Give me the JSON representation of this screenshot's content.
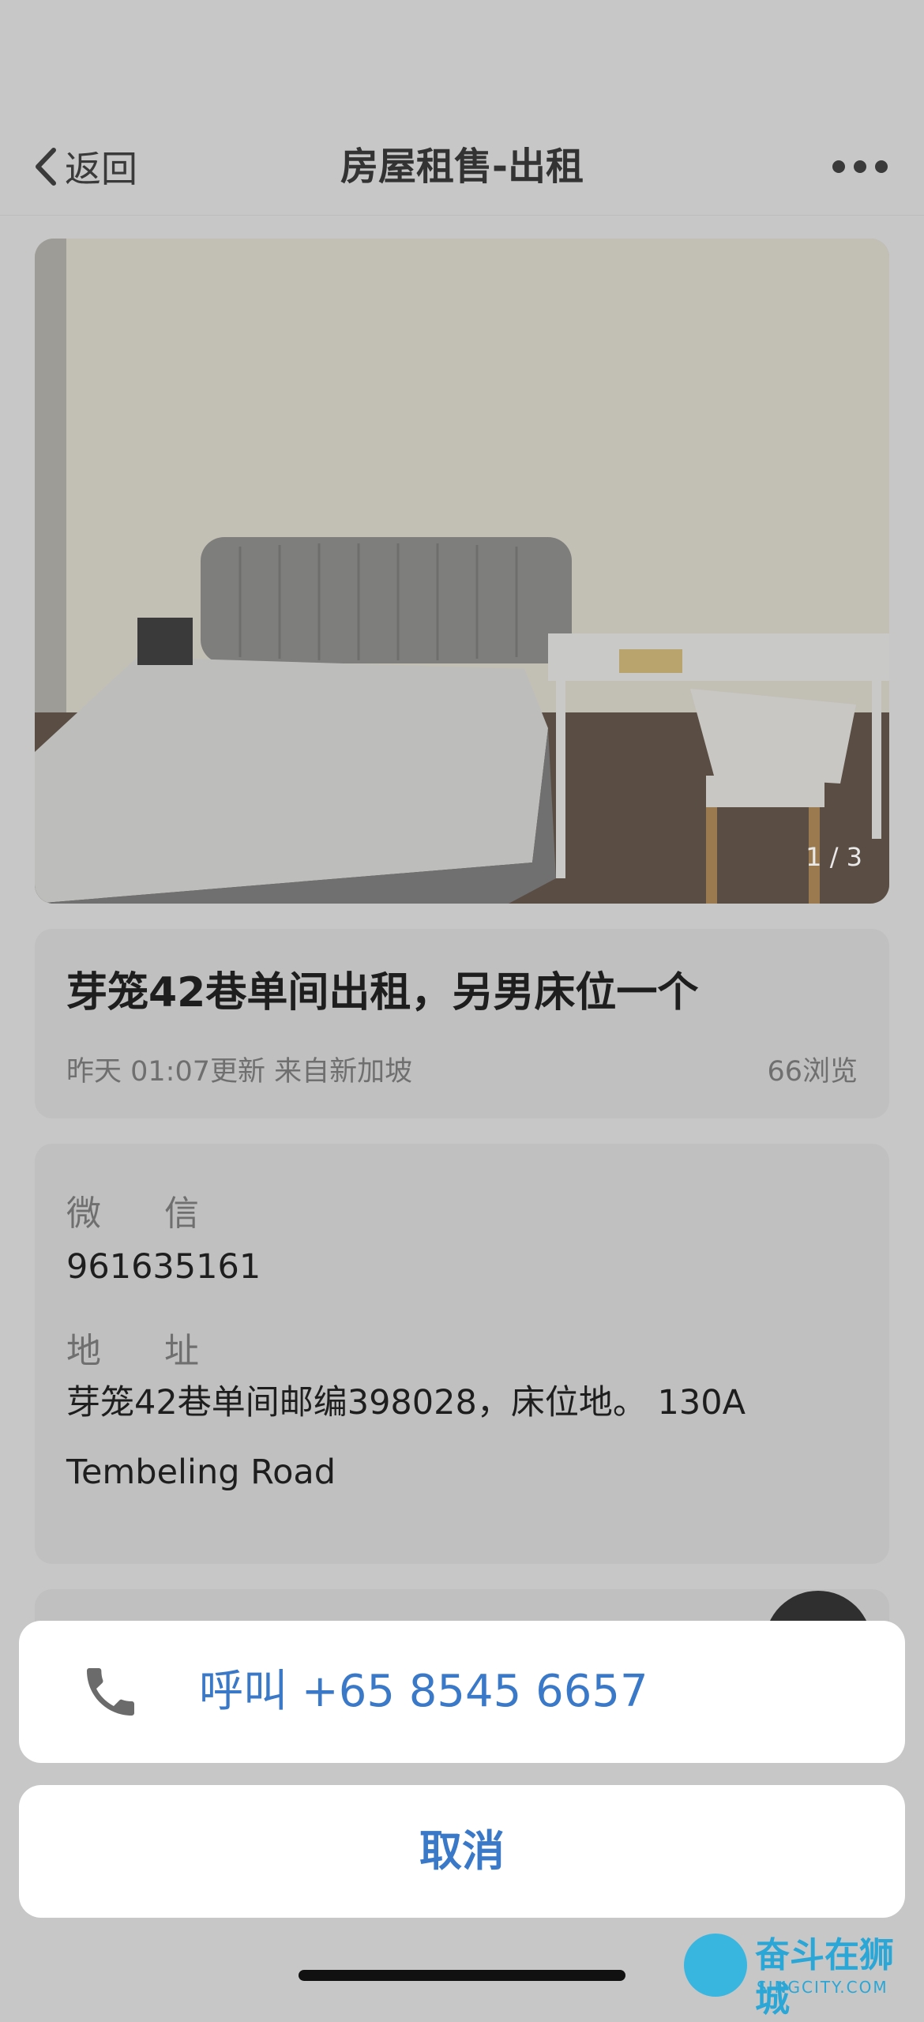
{
  "nav": {
    "back_label": "返回",
    "title": "房屋租售-出租"
  },
  "photo": {
    "counter": "1 / 3"
  },
  "listing": {
    "title": "芽笼42巷单间出租，另男床位一个",
    "meta": "昨天 01:07更新 来自新加坡",
    "views": "66浏览"
  },
  "info": {
    "wechat_label_1": "微",
    "wechat_label_2": "信",
    "wechat_value": "961635161",
    "address_label_1": "地",
    "address_label_2": "址",
    "address_value": "芽笼42巷单间邮编398028，床位地。 130A Tembeling Road"
  },
  "action_sheet": {
    "call_label": "呼叫 +65 8545 6657",
    "cancel_label": "取消"
  },
  "watermark": {
    "name": "奋斗在狮城",
    "domain": "SINGCITY.COM"
  },
  "colors": {
    "accent": "#3a78c8",
    "overlay_bg": "#c7c7c7"
  }
}
